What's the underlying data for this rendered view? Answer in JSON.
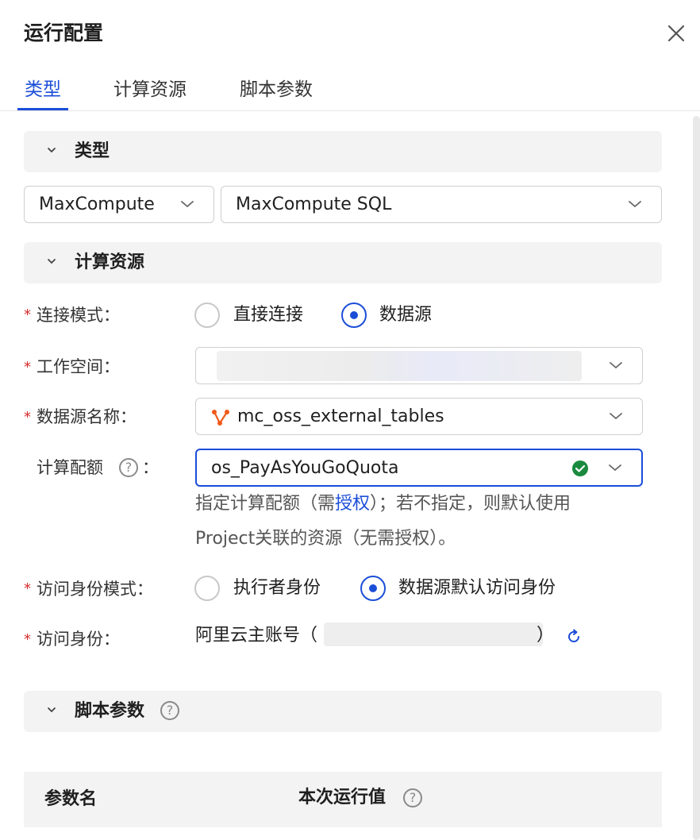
{
  "dialog": {
    "title": "运行配置",
    "close_icon": "close-icon"
  },
  "tabs": [
    {
      "label": "类型",
      "active": true
    },
    {
      "label": "计算资源",
      "active": false
    },
    {
      "label": "脚本参数",
      "active": false
    }
  ],
  "sections": {
    "type": {
      "label": "类型"
    },
    "compute": {
      "label": "计算资源"
    },
    "script_params": {
      "label": "脚本参数"
    }
  },
  "type_selects": {
    "engine": "MaxCompute",
    "node_type": "MaxCompute SQL"
  },
  "form": {
    "connection_mode": {
      "label": "连接模式：",
      "options": [
        "直接连接",
        "数据源"
      ],
      "selected": "数据源"
    },
    "workspace": {
      "label": "工作空间："
    },
    "datasource_name": {
      "label": "数据源名称：",
      "value": "mc_oss_external_tables"
    },
    "quota": {
      "label": "计算配额",
      "value": "os_PayAsYouGoQuota",
      "hint_before": "指定计算配额（需",
      "hint_link": "授权",
      "hint_after": "）；若不指定，则默认使用",
      "hint_line2": "Project关联的资源（无需授权）。"
    },
    "identity_mode": {
      "label": "访问身份模式：",
      "options": [
        "执行者身份",
        "数据源默认访问身份"
      ],
      "selected": "数据源默认访问身份"
    },
    "identity": {
      "label": "访问身份：",
      "value_prefix": "阿里云主账号（",
      "value_suffix": "）"
    }
  },
  "params_table": {
    "columns": [
      "参数名",
      "本次运行值"
    ]
  },
  "colors": {
    "accent": "#1b4ed8",
    "required": "#d52a2a",
    "success": "#1a8a3f",
    "datasource_icon": "#f05a1a"
  }
}
